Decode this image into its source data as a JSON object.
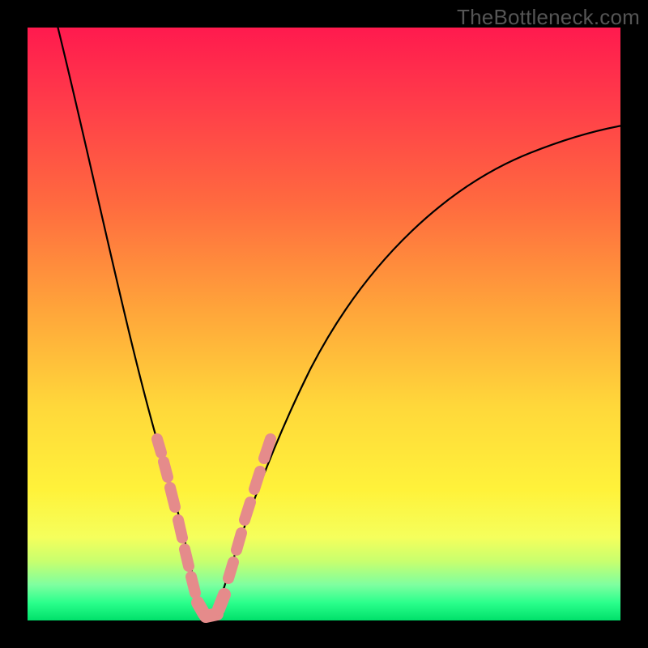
{
  "watermark": "TheBottleneck.com",
  "chart_data": {
    "type": "line",
    "title": "",
    "xlabel": "",
    "ylabel": "",
    "xlim": [
      0,
      100
    ],
    "ylim": [
      0,
      100
    ],
    "grid": false,
    "legend": false,
    "series": [
      {
        "name": "bottleneck-curve",
        "x": [
          5,
          10,
          15,
          20,
          22,
          24,
          26,
          27,
          28,
          30,
          35,
          40,
          45,
          50,
          55,
          60,
          70,
          80,
          90,
          100
        ],
        "values": [
          100,
          78,
          58,
          38,
          28,
          18,
          8,
          2,
          0,
          2,
          12,
          22,
          31,
          39,
          46,
          52,
          62,
          70,
          76,
          81
        ]
      }
    ],
    "markers": {
      "name": "highlight-dots",
      "color": "#e58b8b",
      "points": [
        {
          "x": 19,
          "y": 36
        },
        {
          "x": 20,
          "y": 32
        },
        {
          "x": 21,
          "y": 26
        },
        {
          "x": 22,
          "y": 22
        },
        {
          "x": 23,
          "y": 16
        },
        {
          "x": 24,
          "y": 10
        },
        {
          "x": 25,
          "y": 6
        },
        {
          "x": 26,
          "y": 3
        },
        {
          "x": 27,
          "y": 1
        },
        {
          "x": 28,
          "y": 0
        },
        {
          "x": 29,
          "y": 0
        },
        {
          "x": 30,
          "y": 1
        },
        {
          "x": 31,
          "y": 4
        },
        {
          "x": 32,
          "y": 8
        },
        {
          "x": 33,
          "y": 12
        },
        {
          "x": 34,
          "y": 16
        },
        {
          "x": 35,
          "y": 20
        },
        {
          "x": 36,
          "y": 24
        },
        {
          "x": 37,
          "y": 28
        }
      ]
    }
  }
}
